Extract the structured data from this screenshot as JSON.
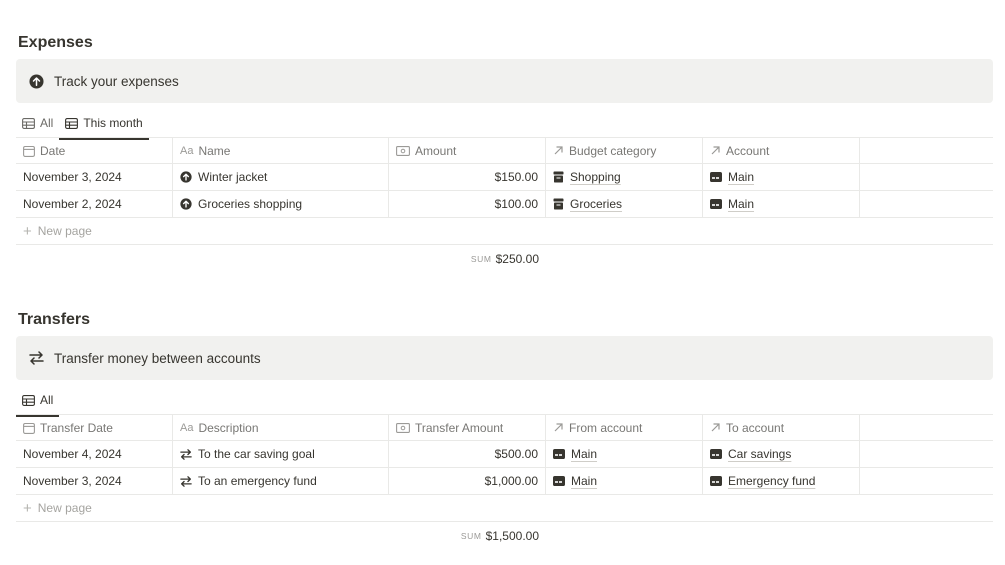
{
  "expenses": {
    "title": "Expenses",
    "callout": "Track your expenses",
    "tabs": [
      {
        "label": "All",
        "active": false
      },
      {
        "label": "This month",
        "active": true
      }
    ],
    "columns": [
      "Date",
      "Name",
      "Amount",
      "Budget category",
      "Account"
    ],
    "rows": [
      {
        "date": "November 3, 2024",
        "name": "Winter jacket",
        "amount": "$150.00",
        "category": "Shopping",
        "account": "Main"
      },
      {
        "date": "November 2, 2024",
        "name": "Groceries shopping",
        "amount": "$100.00",
        "category": "Groceries",
        "account": "Main"
      }
    ],
    "new_page": "New page",
    "sum_label": "SUM",
    "sum_value": "$250.00"
  },
  "transfers": {
    "title": "Transfers",
    "callout": "Transfer money between accounts",
    "tabs": [
      {
        "label": "All",
        "active": false
      }
    ],
    "columns": [
      "Transfer Date",
      "Description",
      "Transfer Amount",
      "From account",
      "To account"
    ],
    "rows": [
      {
        "date": "November 4, 2024",
        "name": "To the car saving goal",
        "amount": "$500.00",
        "from": "Main",
        "to": "Car savings"
      },
      {
        "date": "November 3, 2024",
        "name": "To an emergency fund",
        "amount": "$1,000.00",
        "from": "Main",
        "to": "Emergency fund"
      }
    ],
    "new_page": "New page",
    "sum_label": "SUM",
    "sum_value": "$1,500.00"
  },
  "icons": {
    "callout_expenses": "arrow-up-circle-icon",
    "callout_transfers": "transfer-arrows-icon",
    "tab": "table-icon",
    "date_col": "calendar-icon",
    "name_col": "text-aa-icon",
    "amount_col": "money-icon",
    "relation_col": "arrow-up-right-icon",
    "category_item": "archive-box-icon",
    "account_item": "wallet-card-icon"
  }
}
